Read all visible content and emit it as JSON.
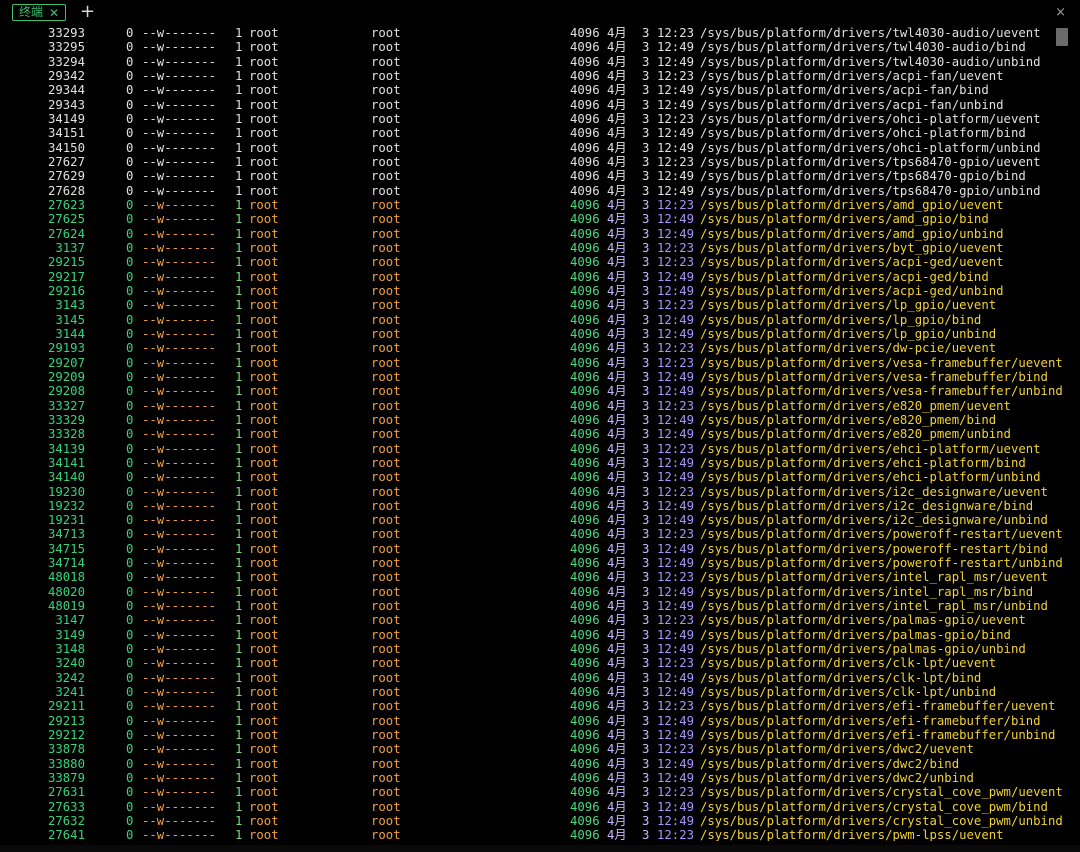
{
  "tab": {
    "label": "终端",
    "close_icon": "✕"
  },
  "new_tab_icon": "+",
  "window_close_icon": "×",
  "colors": {
    "accent": "#3fbf74",
    "inode_exec": "#35d47a",
    "owner": "#f3a13d",
    "path": "#f1d234",
    "time": "#a895ff",
    "plain": "#e0e0e0"
  },
  "listing": [
    {
      "inode": "33293",
      "blocks": "0",
      "perm": "--w-------",
      "links": "1",
      "owner": "root",
      "group": "root",
      "size": "4096",
      "month": "4月",
      "day": "3",
      "time": "12:23",
      "path": "/sys/bus/platform/drivers/twl4030-audio/uevent",
      "style": "plain"
    },
    {
      "inode": "33295",
      "blocks": "0",
      "perm": "--w-------",
      "links": "1",
      "owner": "root",
      "group": "root",
      "size": "4096",
      "month": "4月",
      "day": "3",
      "time": "12:49",
      "path": "/sys/bus/platform/drivers/twl4030-audio/bind",
      "style": "plain"
    },
    {
      "inode": "33294",
      "blocks": "0",
      "perm": "--w-------",
      "links": "1",
      "owner": "root",
      "group": "root",
      "size": "4096",
      "month": "4月",
      "day": "3",
      "time": "12:49",
      "path": "/sys/bus/platform/drivers/twl4030-audio/unbind",
      "style": "plain"
    },
    {
      "inode": "29342",
      "blocks": "0",
      "perm": "--w-------",
      "links": "1",
      "owner": "root",
      "group": "root",
      "size": "4096",
      "month": "4月",
      "day": "3",
      "time": "12:23",
      "path": "/sys/bus/platform/drivers/acpi-fan/uevent",
      "style": "plain"
    },
    {
      "inode": "29344",
      "blocks": "0",
      "perm": "--w-------",
      "links": "1",
      "owner": "root",
      "group": "root",
      "size": "4096",
      "month": "4月",
      "day": "3",
      "time": "12:49",
      "path": "/sys/bus/platform/drivers/acpi-fan/bind",
      "style": "plain"
    },
    {
      "inode": "29343",
      "blocks": "0",
      "perm": "--w-------",
      "links": "1",
      "owner": "root",
      "group": "root",
      "size": "4096",
      "month": "4月",
      "day": "3",
      "time": "12:49",
      "path": "/sys/bus/platform/drivers/acpi-fan/unbind",
      "style": "plain"
    },
    {
      "inode": "34149",
      "blocks": "0",
      "perm": "--w-------",
      "links": "1",
      "owner": "root",
      "group": "root",
      "size": "4096",
      "month": "4月",
      "day": "3",
      "time": "12:23",
      "path": "/sys/bus/platform/drivers/ohci-platform/uevent",
      "style": "plain"
    },
    {
      "inode": "34151",
      "blocks": "0",
      "perm": "--w-------",
      "links": "1",
      "owner": "root",
      "group": "root",
      "size": "4096",
      "month": "4月",
      "day": "3",
      "time": "12:49",
      "path": "/sys/bus/platform/drivers/ohci-platform/bind",
      "style": "plain"
    },
    {
      "inode": "34150",
      "blocks": "0",
      "perm": "--w-------",
      "links": "1",
      "owner": "root",
      "group": "root",
      "size": "4096",
      "month": "4月",
      "day": "3",
      "time": "12:49",
      "path": "/sys/bus/platform/drivers/ohci-platform/unbind",
      "style": "plain"
    },
    {
      "inode": "27627",
      "blocks": "0",
      "perm": "--w-------",
      "links": "1",
      "owner": "root",
      "group": "root",
      "size": "4096",
      "month": "4月",
      "day": "3",
      "time": "12:23",
      "path": "/sys/bus/platform/drivers/tps68470-gpio/uevent",
      "style": "plain"
    },
    {
      "inode": "27629",
      "blocks": "0",
      "perm": "--w-------",
      "links": "1",
      "owner": "root",
      "group": "root",
      "size": "4096",
      "month": "4月",
      "day": "3",
      "time": "12:49",
      "path": "/sys/bus/platform/drivers/tps68470-gpio/bind",
      "style": "plain"
    },
    {
      "inode": "27628",
      "blocks": "0",
      "perm": "--w-------",
      "links": "1",
      "owner": "root",
      "group": "root",
      "size": "4096",
      "month": "4月",
      "day": "3",
      "time": "12:49",
      "path": "/sys/bus/platform/drivers/tps68470-gpio/unbind",
      "style": "plain"
    },
    {
      "inode": "27623",
      "blocks": "0",
      "perm": "--w-------",
      "links": "1",
      "owner": "root",
      "group": "root",
      "size": "4096",
      "month": "4月",
      "day": "3",
      "time": "12:23",
      "path": "/sys/bus/platform/drivers/amd_gpio/uevent",
      "style": "colored"
    },
    {
      "inode": "27625",
      "blocks": "0",
      "perm": "--w-------",
      "links": "1",
      "owner": "root",
      "group": "root",
      "size": "4096",
      "month": "4月",
      "day": "3",
      "time": "12:49",
      "path": "/sys/bus/platform/drivers/amd_gpio/bind",
      "style": "colored"
    },
    {
      "inode": "27624",
      "blocks": "0",
      "perm": "--w-------",
      "links": "1",
      "owner": "root",
      "group": "root",
      "size": "4096",
      "month": "4月",
      "day": "3",
      "time": "12:49",
      "path": "/sys/bus/platform/drivers/amd_gpio/unbind",
      "style": "colored"
    },
    {
      "inode": "3137",
      "blocks": "0",
      "perm": "--w-------",
      "links": "1",
      "owner": "root",
      "group": "root",
      "size": "4096",
      "month": "4月",
      "day": "3",
      "time": "12:23",
      "path": "/sys/bus/platform/drivers/byt_gpio/uevent",
      "style": "colored"
    },
    {
      "inode": "29215",
      "blocks": "0",
      "perm": "--w-------",
      "links": "1",
      "owner": "root",
      "group": "root",
      "size": "4096",
      "month": "4月",
      "day": "3",
      "time": "12:23",
      "path": "/sys/bus/platform/drivers/acpi-ged/uevent",
      "style": "colored"
    },
    {
      "inode": "29217",
      "blocks": "0",
      "perm": "--w-------",
      "links": "1",
      "owner": "root",
      "group": "root",
      "size": "4096",
      "month": "4月",
      "day": "3",
      "time": "12:49",
      "path": "/sys/bus/platform/drivers/acpi-ged/bind",
      "style": "colored"
    },
    {
      "inode": "29216",
      "blocks": "0",
      "perm": "--w-------",
      "links": "1",
      "owner": "root",
      "group": "root",
      "size": "4096",
      "month": "4月",
      "day": "3",
      "time": "12:49",
      "path": "/sys/bus/platform/drivers/acpi-ged/unbind",
      "style": "colored"
    },
    {
      "inode": "3143",
      "blocks": "0",
      "perm": "--w-------",
      "links": "1",
      "owner": "root",
      "group": "root",
      "size": "4096",
      "month": "4月",
      "day": "3",
      "time": "12:23",
      "path": "/sys/bus/platform/drivers/lp_gpio/uevent",
      "style": "colored"
    },
    {
      "inode": "3145",
      "blocks": "0",
      "perm": "--w-------",
      "links": "1",
      "owner": "root",
      "group": "root",
      "size": "4096",
      "month": "4月",
      "day": "3",
      "time": "12:49",
      "path": "/sys/bus/platform/drivers/lp_gpio/bind",
      "style": "colored"
    },
    {
      "inode": "3144",
      "blocks": "0",
      "perm": "--w-------",
      "links": "1",
      "owner": "root",
      "group": "root",
      "size": "4096",
      "month": "4月",
      "day": "3",
      "time": "12:49",
      "path": "/sys/bus/platform/drivers/lp_gpio/unbind",
      "style": "colored"
    },
    {
      "inode": "29193",
      "blocks": "0",
      "perm": "--w-------",
      "links": "1",
      "owner": "root",
      "group": "root",
      "size": "4096",
      "month": "4月",
      "day": "3",
      "time": "12:23",
      "path": "/sys/bus/platform/drivers/dw-pcie/uevent",
      "style": "colored"
    },
    {
      "inode": "29207",
      "blocks": "0",
      "perm": "--w-------",
      "links": "1",
      "owner": "root",
      "group": "root",
      "size": "4096",
      "month": "4月",
      "day": "3",
      "time": "12:23",
      "path": "/sys/bus/platform/drivers/vesa-framebuffer/uevent",
      "style": "colored"
    },
    {
      "inode": "29209",
      "blocks": "0",
      "perm": "--w-------",
      "links": "1",
      "owner": "root",
      "group": "root",
      "size": "4096",
      "month": "4月",
      "day": "3",
      "time": "12:49",
      "path": "/sys/bus/platform/drivers/vesa-framebuffer/bind",
      "style": "colored"
    },
    {
      "inode": "29208",
      "blocks": "0",
      "perm": "--w-------",
      "links": "1",
      "owner": "root",
      "group": "root",
      "size": "4096",
      "month": "4月",
      "day": "3",
      "time": "12:49",
      "path": "/sys/bus/platform/drivers/vesa-framebuffer/unbind",
      "style": "colored"
    },
    {
      "inode": "33327",
      "blocks": "0",
      "perm": "--w-------",
      "links": "1",
      "owner": "root",
      "group": "root",
      "size": "4096",
      "month": "4月",
      "day": "3",
      "time": "12:23",
      "path": "/sys/bus/platform/drivers/e820_pmem/uevent",
      "style": "colored"
    },
    {
      "inode": "33329",
      "blocks": "0",
      "perm": "--w-------",
      "links": "1",
      "owner": "root",
      "group": "root",
      "size": "4096",
      "month": "4月",
      "day": "3",
      "time": "12:49",
      "path": "/sys/bus/platform/drivers/e820_pmem/bind",
      "style": "colored"
    },
    {
      "inode": "33328",
      "blocks": "0",
      "perm": "--w-------",
      "links": "1",
      "owner": "root",
      "group": "root",
      "size": "4096",
      "month": "4月",
      "day": "3",
      "time": "12:49",
      "path": "/sys/bus/platform/drivers/e820_pmem/unbind",
      "style": "colored"
    },
    {
      "inode": "34139",
      "blocks": "0",
      "perm": "--w-------",
      "links": "1",
      "owner": "root",
      "group": "root",
      "size": "4096",
      "month": "4月",
      "day": "3",
      "time": "12:23",
      "path": "/sys/bus/platform/drivers/ehci-platform/uevent",
      "style": "colored"
    },
    {
      "inode": "34141",
      "blocks": "0",
      "perm": "--w-------",
      "links": "1",
      "owner": "root",
      "group": "root",
      "size": "4096",
      "month": "4月",
      "day": "3",
      "time": "12:49",
      "path": "/sys/bus/platform/drivers/ehci-platform/bind",
      "style": "colored"
    },
    {
      "inode": "34140",
      "blocks": "0",
      "perm": "--w-------",
      "links": "1",
      "owner": "root",
      "group": "root",
      "size": "4096",
      "month": "4月",
      "day": "3",
      "time": "12:49",
      "path": "/sys/bus/platform/drivers/ehci-platform/unbind",
      "style": "colored"
    },
    {
      "inode": "19230",
      "blocks": "0",
      "perm": "--w-------",
      "links": "1",
      "owner": "root",
      "group": "root",
      "size": "4096",
      "month": "4月",
      "day": "3",
      "time": "12:23",
      "path": "/sys/bus/platform/drivers/i2c_designware/uevent",
      "style": "colored"
    },
    {
      "inode": "19232",
      "blocks": "0",
      "perm": "--w-------",
      "links": "1",
      "owner": "root",
      "group": "root",
      "size": "4096",
      "month": "4月",
      "day": "3",
      "time": "12:49",
      "path": "/sys/bus/platform/drivers/i2c_designware/bind",
      "style": "colored"
    },
    {
      "inode": "19231",
      "blocks": "0",
      "perm": "--w-------",
      "links": "1",
      "owner": "root",
      "group": "root",
      "size": "4096",
      "month": "4月",
      "day": "3",
      "time": "12:49",
      "path": "/sys/bus/platform/drivers/i2c_designware/unbind",
      "style": "colored"
    },
    {
      "inode": "34713",
      "blocks": "0",
      "perm": "--w-------",
      "links": "1",
      "owner": "root",
      "group": "root",
      "size": "4096",
      "month": "4月",
      "day": "3",
      "time": "12:23",
      "path": "/sys/bus/platform/drivers/poweroff-restart/uevent",
      "style": "colored"
    },
    {
      "inode": "34715",
      "blocks": "0",
      "perm": "--w-------",
      "links": "1",
      "owner": "root",
      "group": "root",
      "size": "4096",
      "month": "4月",
      "day": "3",
      "time": "12:49",
      "path": "/sys/bus/platform/drivers/poweroff-restart/bind",
      "style": "colored"
    },
    {
      "inode": "34714",
      "blocks": "0",
      "perm": "--w-------",
      "links": "1",
      "owner": "root",
      "group": "root",
      "size": "4096",
      "month": "4月",
      "day": "3",
      "time": "12:49",
      "path": "/sys/bus/platform/drivers/poweroff-restart/unbind",
      "style": "colored"
    },
    {
      "inode": "48018",
      "blocks": "0",
      "perm": "--w-------",
      "links": "1",
      "owner": "root",
      "group": "root",
      "size": "4096",
      "month": "4月",
      "day": "3",
      "time": "12:23",
      "path": "/sys/bus/platform/drivers/intel_rapl_msr/uevent",
      "style": "colored"
    },
    {
      "inode": "48020",
      "blocks": "0",
      "perm": "--w-------",
      "links": "1",
      "owner": "root",
      "group": "root",
      "size": "4096",
      "month": "4月",
      "day": "3",
      "time": "12:49",
      "path": "/sys/bus/platform/drivers/intel_rapl_msr/bind",
      "style": "colored"
    },
    {
      "inode": "48019",
      "blocks": "0",
      "perm": "--w-------",
      "links": "1",
      "owner": "root",
      "group": "root",
      "size": "4096",
      "month": "4月",
      "day": "3",
      "time": "12:49",
      "path": "/sys/bus/platform/drivers/intel_rapl_msr/unbind",
      "style": "colored"
    },
    {
      "inode": "3147",
      "blocks": "0",
      "perm": "--w-------",
      "links": "1",
      "owner": "root",
      "group": "root",
      "size": "4096",
      "month": "4月",
      "day": "3",
      "time": "12:23",
      "path": "/sys/bus/platform/drivers/palmas-gpio/uevent",
      "style": "colored"
    },
    {
      "inode": "3149",
      "blocks": "0",
      "perm": "--w-------",
      "links": "1",
      "owner": "root",
      "group": "root",
      "size": "4096",
      "month": "4月",
      "day": "3",
      "time": "12:49",
      "path": "/sys/bus/platform/drivers/palmas-gpio/bind",
      "style": "colored"
    },
    {
      "inode": "3148",
      "blocks": "0",
      "perm": "--w-------",
      "links": "1",
      "owner": "root",
      "group": "root",
      "size": "4096",
      "month": "4月",
      "day": "3",
      "time": "12:49",
      "path": "/sys/bus/platform/drivers/palmas-gpio/unbind",
      "style": "colored"
    },
    {
      "inode": "3240",
      "blocks": "0",
      "perm": "--w-------",
      "links": "1",
      "owner": "root",
      "group": "root",
      "size": "4096",
      "month": "4月",
      "day": "3",
      "time": "12:23",
      "path": "/sys/bus/platform/drivers/clk-lpt/uevent",
      "style": "colored"
    },
    {
      "inode": "3242",
      "blocks": "0",
      "perm": "--w-------",
      "links": "1",
      "owner": "root",
      "group": "root",
      "size": "4096",
      "month": "4月",
      "day": "3",
      "time": "12:49",
      "path": "/sys/bus/platform/drivers/clk-lpt/bind",
      "style": "colored"
    },
    {
      "inode": "3241",
      "blocks": "0",
      "perm": "--w-------",
      "links": "1",
      "owner": "root",
      "group": "root",
      "size": "4096",
      "month": "4月",
      "day": "3",
      "time": "12:49",
      "path": "/sys/bus/platform/drivers/clk-lpt/unbind",
      "style": "colored"
    },
    {
      "inode": "29211",
      "blocks": "0",
      "perm": "--w-------",
      "links": "1",
      "owner": "root",
      "group": "root",
      "size": "4096",
      "month": "4月",
      "day": "3",
      "time": "12:23",
      "path": "/sys/bus/platform/drivers/efi-framebuffer/uevent",
      "style": "colored"
    },
    {
      "inode": "29213",
      "blocks": "0",
      "perm": "--w-------",
      "links": "1",
      "owner": "root",
      "group": "root",
      "size": "4096",
      "month": "4月",
      "day": "3",
      "time": "12:49",
      "path": "/sys/bus/platform/drivers/efi-framebuffer/bind",
      "style": "colored"
    },
    {
      "inode": "29212",
      "blocks": "0",
      "perm": "--w-------",
      "links": "1",
      "owner": "root",
      "group": "root",
      "size": "4096",
      "month": "4月",
      "day": "3",
      "time": "12:49",
      "path": "/sys/bus/platform/drivers/efi-framebuffer/unbind",
      "style": "colored"
    },
    {
      "inode": "33878",
      "blocks": "0",
      "perm": "--w-------",
      "links": "1",
      "owner": "root",
      "group": "root",
      "size": "4096",
      "month": "4月",
      "day": "3",
      "time": "12:23",
      "path": "/sys/bus/platform/drivers/dwc2/uevent",
      "style": "colored"
    },
    {
      "inode": "33880",
      "blocks": "0",
      "perm": "--w-------",
      "links": "1",
      "owner": "root",
      "group": "root",
      "size": "4096",
      "month": "4月",
      "day": "3",
      "time": "12:49",
      "path": "/sys/bus/platform/drivers/dwc2/bind",
      "style": "colored"
    },
    {
      "inode": "33879",
      "blocks": "0",
      "perm": "--w-------",
      "links": "1",
      "owner": "root",
      "group": "root",
      "size": "4096",
      "month": "4月",
      "day": "3",
      "time": "12:49",
      "path": "/sys/bus/platform/drivers/dwc2/unbind",
      "style": "colored"
    },
    {
      "inode": "27631",
      "blocks": "0",
      "perm": "--w-------",
      "links": "1",
      "owner": "root",
      "group": "root",
      "size": "4096",
      "month": "4月",
      "day": "3",
      "time": "12:23",
      "path": "/sys/bus/platform/drivers/crystal_cove_pwm/uevent",
      "style": "colored"
    },
    {
      "inode": "27633",
      "blocks": "0",
      "perm": "--w-------",
      "links": "1",
      "owner": "root",
      "group": "root",
      "size": "4096",
      "month": "4月",
      "day": "3",
      "time": "12:49",
      "path": "/sys/bus/platform/drivers/crystal_cove_pwm/bind",
      "style": "colored"
    },
    {
      "inode": "27632",
      "blocks": "0",
      "perm": "--w-------",
      "links": "1",
      "owner": "root",
      "group": "root",
      "size": "4096",
      "month": "4月",
      "day": "3",
      "time": "12:49",
      "path": "/sys/bus/platform/drivers/crystal_cove_pwm/unbind",
      "style": "colored"
    },
    {
      "inode": "27641",
      "blocks": "0",
      "perm": "--w-------",
      "links": "1",
      "owner": "root",
      "group": "root",
      "size": "4096",
      "month": "4月",
      "day": "3",
      "time": "12:23",
      "path": "/sys/bus/platform/drivers/pwm-lpss/uevent",
      "style": "colored"
    }
  ]
}
